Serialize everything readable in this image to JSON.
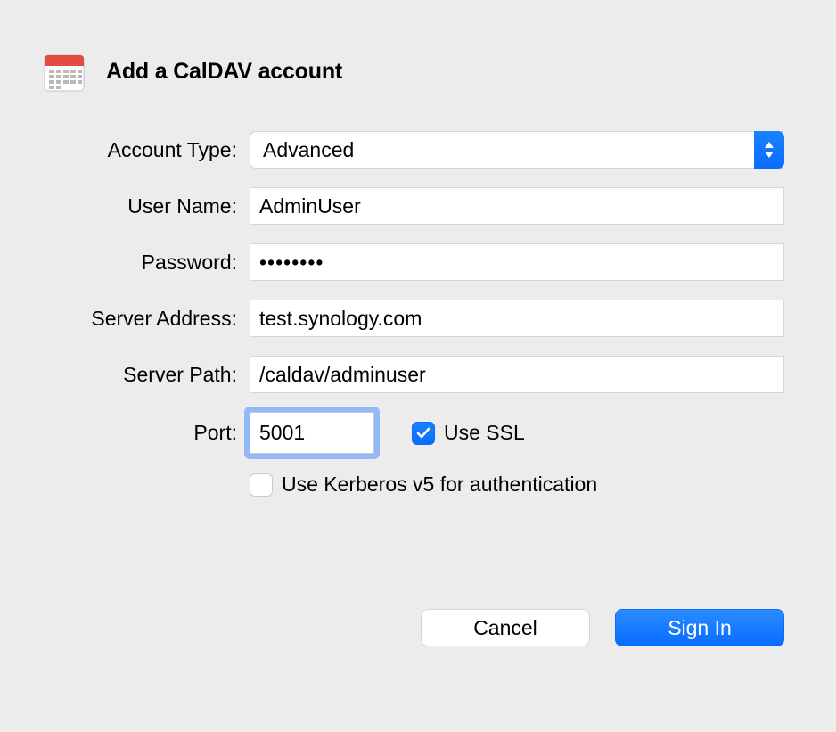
{
  "dialog": {
    "title": "Add a CalDAV account"
  },
  "form": {
    "account_type": {
      "label": "Account Type:",
      "value": "Advanced"
    },
    "user_name": {
      "label": "User Name:",
      "value": "AdminUser"
    },
    "password": {
      "label": "Password:",
      "value": "••••••••"
    },
    "server_addr": {
      "label": "Server Address:",
      "value": "test.synology.com"
    },
    "server_path": {
      "label": "Server Path:",
      "value": "/caldav/adminuser"
    },
    "port": {
      "label": "Port:",
      "value": "5001"
    },
    "use_ssl": {
      "label": "Use SSL",
      "checked": true
    },
    "kerberos": {
      "label": "Use Kerberos v5 for authentication",
      "checked": false
    }
  },
  "buttons": {
    "cancel": "Cancel",
    "signin": "Sign In"
  }
}
